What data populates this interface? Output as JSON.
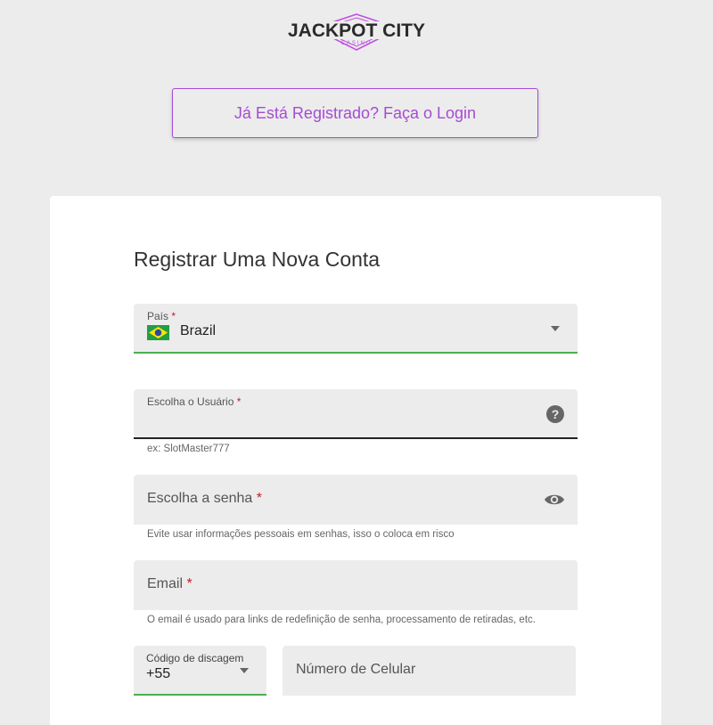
{
  "brand": {
    "logo_text": "JACKPOT CITY",
    "logo_subtext": "CASINO",
    "accent_color": "#a54bd3"
  },
  "login_button": {
    "label": "Já Está Registrado? Faça o Login"
  },
  "form": {
    "title": "Registrar Uma Nova Conta",
    "country": {
      "label": "País",
      "required_mark": "*",
      "value": "Brazil",
      "flag_icon": "brazil-flag-icon"
    },
    "username": {
      "label": "Escolha o Usuário",
      "required_mark": "*",
      "helper": "ex: SlotMaster777",
      "icon": "help-circle-icon"
    },
    "password": {
      "label": "Escolha a senha",
      "required_mark": "*",
      "helper": "Evite usar informações pessoais em senhas, isso o coloca em risco",
      "icon": "eye-icon"
    },
    "email": {
      "label": "Email",
      "required_mark": "*",
      "helper": "O email é usado para links de redefinição de senha, processamento de retiradas, etc."
    },
    "dial_code": {
      "label": "Código de discagem",
      "value": "+55"
    },
    "phone": {
      "placeholder": "Número de Celular"
    }
  }
}
